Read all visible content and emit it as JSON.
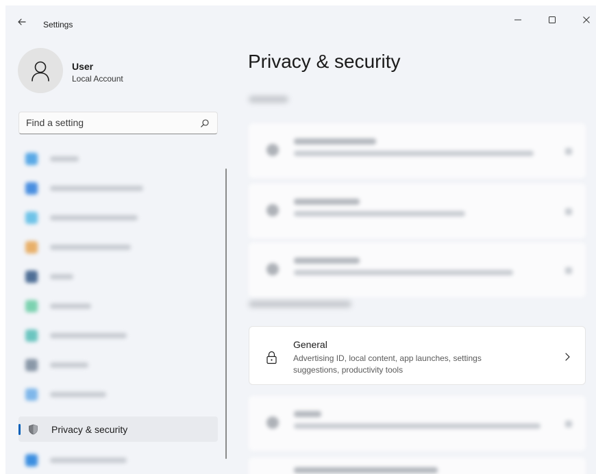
{
  "window": {
    "app_title": "Settings"
  },
  "profile": {
    "name": "User",
    "account_type": "Local Account"
  },
  "search": {
    "placeholder": "Find a setting"
  },
  "sidebar": {
    "active_item": {
      "label": "Privacy & security"
    }
  },
  "main": {
    "title": "Privacy & security",
    "general_card": {
      "title": "General",
      "description": "Advertising ID, local content, app launches, settings suggestions, productivity tools"
    }
  },
  "colors": {
    "accent": "#005fb8",
    "window_background": "#f2f4f8",
    "card_background": "#ffffff"
  },
  "icons": [
    "back-arrow-icon",
    "minimize-icon",
    "maximize-icon",
    "close-icon",
    "person-icon",
    "search-icon",
    "shield-icon",
    "lock-icon",
    "chevron-right-icon"
  ]
}
